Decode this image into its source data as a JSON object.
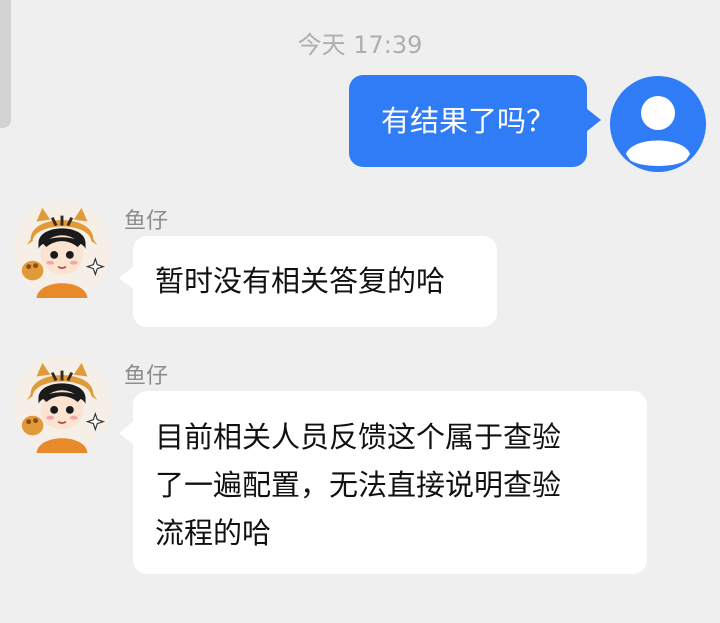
{
  "timestamp": "今天 17:39",
  "outgoing": {
    "text": "有结果了吗？",
    "bubble_color": "#2f7cf6"
  },
  "incoming": [
    {
      "sender": "鱼仔",
      "lines": [
        "暂时没有相关答复的哈"
      ]
    },
    {
      "sender": "鱼仔",
      "lines": [
        "目前相关人员反馈这个属于查验",
        "了一遍配置，无法直接说明查验",
        "流程的哈"
      ]
    }
  ],
  "colors": {
    "background": "#efefef",
    "accent": "#2f7cf6",
    "incoming_bubble": "#ffffff"
  }
}
